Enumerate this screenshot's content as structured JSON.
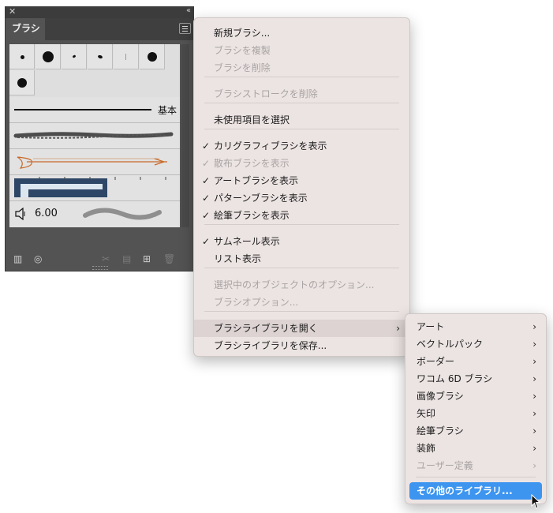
{
  "panel": {
    "close_glyph": "✕",
    "collapse_glyph": "‹‹",
    "tab_label": "ブラシ",
    "basic_label": "基本",
    "size_value": "6.00"
  },
  "menu": {
    "items": [
      {
        "label": "新規ブラシ...",
        "enabled": true,
        "checked": false
      },
      {
        "label": "ブラシを複製",
        "enabled": false,
        "checked": false
      },
      {
        "label": "ブラシを削除",
        "enabled": false,
        "checked": false
      },
      {
        "label": "ブラシストロークを削除",
        "enabled": false,
        "checked": false
      },
      {
        "label": "未使用項目を選択",
        "enabled": true,
        "checked": false
      },
      {
        "label": "カリグラフィブラシを表示",
        "enabled": true,
        "checked": true
      },
      {
        "label": "散布ブラシを表示",
        "enabled": false,
        "checked": true
      },
      {
        "label": "アートブラシを表示",
        "enabled": true,
        "checked": true
      },
      {
        "label": "パターンブラシを表示",
        "enabled": true,
        "checked": true
      },
      {
        "label": "絵筆ブラシを表示",
        "enabled": true,
        "checked": true
      },
      {
        "label": "サムネール表示",
        "enabled": true,
        "checked": true
      },
      {
        "label": "リスト表示",
        "enabled": true,
        "checked": false
      },
      {
        "label": "選択中のオブジェクトのオプション...",
        "enabled": false,
        "checked": false
      },
      {
        "label": "ブラシオプション...",
        "enabled": false,
        "checked": false
      },
      {
        "label": "ブラシライブラリを開く",
        "enabled": true,
        "checked": false,
        "submenu": true
      },
      {
        "label": "ブラシライブラリを保存...",
        "enabled": true,
        "checked": false
      }
    ],
    "check_glyph": "✓",
    "arrow_glyph": "›"
  },
  "submenu": {
    "items": [
      {
        "label": "アート",
        "enabled": true
      },
      {
        "label": "ベクトルパック",
        "enabled": true
      },
      {
        "label": "ボーダー",
        "enabled": true
      },
      {
        "label": "ワコム 6D ブラシ",
        "enabled": true
      },
      {
        "label": "画像ブラシ",
        "enabled": true
      },
      {
        "label": "矢印",
        "enabled": true
      },
      {
        "label": "絵筆ブラシ",
        "enabled": true
      },
      {
        "label": "装飾",
        "enabled": true
      },
      {
        "label": "ユーザー定義",
        "enabled": false
      }
    ],
    "selected_label": "その他のライブラリ..."
  },
  "colors": {
    "menu_bg": "#ece4e3",
    "highlight": "#3d95f0",
    "panel_bg": "#535353"
  }
}
